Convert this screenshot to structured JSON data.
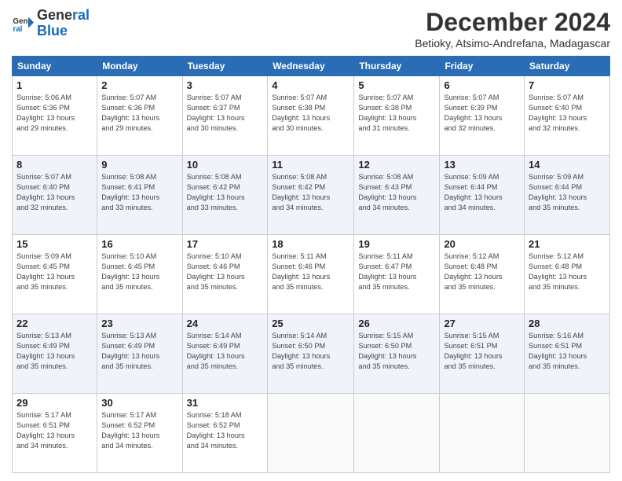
{
  "logo": {
    "line1": "General",
    "line2": "Blue"
  },
  "title": "December 2024",
  "subtitle": "Betioky, Atsimo-Andrefana, Madagascar",
  "header_days": [
    "Sunday",
    "Monday",
    "Tuesday",
    "Wednesday",
    "Thursday",
    "Friday",
    "Saturday"
  ],
  "weeks": [
    [
      {
        "day": "1",
        "info": "Sunrise: 5:06 AM\nSunset: 6:36 PM\nDaylight: 13 hours\nand 29 minutes."
      },
      {
        "day": "2",
        "info": "Sunrise: 5:07 AM\nSunset: 6:36 PM\nDaylight: 13 hours\nand 29 minutes."
      },
      {
        "day": "3",
        "info": "Sunrise: 5:07 AM\nSunset: 6:37 PM\nDaylight: 13 hours\nand 30 minutes."
      },
      {
        "day": "4",
        "info": "Sunrise: 5:07 AM\nSunset: 6:38 PM\nDaylight: 13 hours\nand 30 minutes."
      },
      {
        "day": "5",
        "info": "Sunrise: 5:07 AM\nSunset: 6:38 PM\nDaylight: 13 hours\nand 31 minutes."
      },
      {
        "day": "6",
        "info": "Sunrise: 5:07 AM\nSunset: 6:39 PM\nDaylight: 13 hours\nand 32 minutes."
      },
      {
        "day": "7",
        "info": "Sunrise: 5:07 AM\nSunset: 6:40 PM\nDaylight: 13 hours\nand 32 minutes."
      }
    ],
    [
      {
        "day": "8",
        "info": "Sunrise: 5:07 AM\nSunset: 6:40 PM\nDaylight: 13 hours\nand 32 minutes."
      },
      {
        "day": "9",
        "info": "Sunrise: 5:08 AM\nSunset: 6:41 PM\nDaylight: 13 hours\nand 33 minutes."
      },
      {
        "day": "10",
        "info": "Sunrise: 5:08 AM\nSunset: 6:42 PM\nDaylight: 13 hours\nand 33 minutes."
      },
      {
        "day": "11",
        "info": "Sunrise: 5:08 AM\nSunset: 6:42 PM\nDaylight: 13 hours\nand 34 minutes."
      },
      {
        "day": "12",
        "info": "Sunrise: 5:08 AM\nSunset: 6:43 PM\nDaylight: 13 hours\nand 34 minutes."
      },
      {
        "day": "13",
        "info": "Sunrise: 5:09 AM\nSunset: 6:44 PM\nDaylight: 13 hours\nand 34 minutes."
      },
      {
        "day": "14",
        "info": "Sunrise: 5:09 AM\nSunset: 6:44 PM\nDaylight: 13 hours\nand 35 minutes."
      }
    ],
    [
      {
        "day": "15",
        "info": "Sunrise: 5:09 AM\nSunset: 6:45 PM\nDaylight: 13 hours\nand 35 minutes."
      },
      {
        "day": "16",
        "info": "Sunrise: 5:10 AM\nSunset: 6:45 PM\nDaylight: 13 hours\nand 35 minutes."
      },
      {
        "day": "17",
        "info": "Sunrise: 5:10 AM\nSunset: 6:46 PM\nDaylight: 13 hours\nand 35 minutes."
      },
      {
        "day": "18",
        "info": "Sunrise: 5:11 AM\nSunset: 6:46 PM\nDaylight: 13 hours\nand 35 minutes."
      },
      {
        "day": "19",
        "info": "Sunrise: 5:11 AM\nSunset: 6:47 PM\nDaylight: 13 hours\nand 35 minutes."
      },
      {
        "day": "20",
        "info": "Sunrise: 5:12 AM\nSunset: 6:48 PM\nDaylight: 13 hours\nand 35 minutes."
      },
      {
        "day": "21",
        "info": "Sunrise: 5:12 AM\nSunset: 6:48 PM\nDaylight: 13 hours\nand 35 minutes."
      }
    ],
    [
      {
        "day": "22",
        "info": "Sunrise: 5:13 AM\nSunset: 6:49 PM\nDaylight: 13 hours\nand 35 minutes."
      },
      {
        "day": "23",
        "info": "Sunrise: 5:13 AM\nSunset: 6:49 PM\nDaylight: 13 hours\nand 35 minutes."
      },
      {
        "day": "24",
        "info": "Sunrise: 5:14 AM\nSunset: 6:49 PM\nDaylight: 13 hours\nand 35 minutes."
      },
      {
        "day": "25",
        "info": "Sunrise: 5:14 AM\nSunset: 6:50 PM\nDaylight: 13 hours\nand 35 minutes."
      },
      {
        "day": "26",
        "info": "Sunrise: 5:15 AM\nSunset: 6:50 PM\nDaylight: 13 hours\nand 35 minutes."
      },
      {
        "day": "27",
        "info": "Sunrise: 5:15 AM\nSunset: 6:51 PM\nDaylight: 13 hours\nand 35 minutes."
      },
      {
        "day": "28",
        "info": "Sunrise: 5:16 AM\nSunset: 6:51 PM\nDaylight: 13 hours\nand 35 minutes."
      }
    ],
    [
      {
        "day": "29",
        "info": "Sunrise: 5:17 AM\nSunset: 6:51 PM\nDaylight: 13 hours\nand 34 minutes."
      },
      {
        "day": "30",
        "info": "Sunrise: 5:17 AM\nSunset: 6:52 PM\nDaylight: 13 hours\nand 34 minutes."
      },
      {
        "day": "31",
        "info": "Sunrise: 5:18 AM\nSunset: 6:52 PM\nDaylight: 13 hours\nand 34 minutes."
      },
      {
        "day": "",
        "info": ""
      },
      {
        "day": "",
        "info": ""
      },
      {
        "day": "",
        "info": ""
      },
      {
        "day": "",
        "info": ""
      }
    ]
  ]
}
